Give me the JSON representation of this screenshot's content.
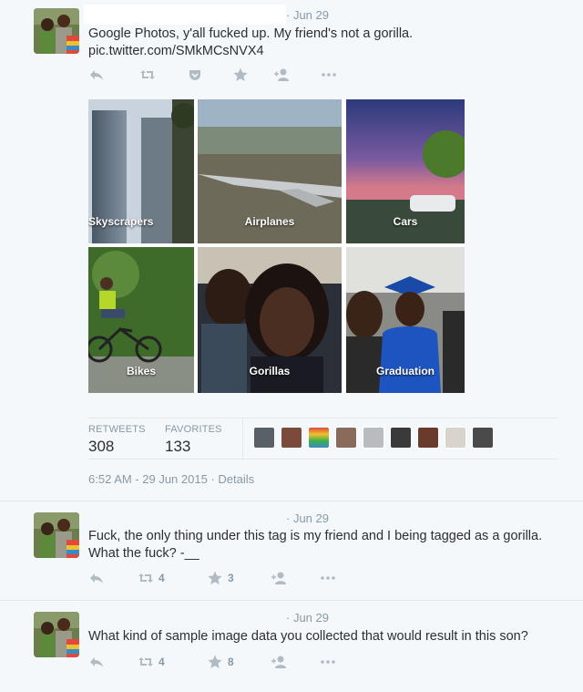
{
  "tweets": [
    {
      "date": "· Jun 29",
      "text_line1": "Google Photos, y'all fucked up. My friend's not a gorilla.",
      "link": "pic.twitter.com/SMkMCsNVX4",
      "actions": [
        {
          "icon": "reply-icon",
          "count": ""
        },
        {
          "icon": "retweet-icon",
          "count": ""
        },
        {
          "icon": "pocket-icon",
          "count": ""
        },
        {
          "icon": "star-icon",
          "count": ""
        },
        {
          "icon": "follow-icon",
          "count": ""
        },
        {
          "icon": "more-icon",
          "count": ""
        }
      ],
      "photo_grid": [
        {
          "label": "Skyscrapers"
        },
        {
          "label": "Airplanes"
        },
        {
          "label": "Cars"
        },
        {
          "label": "Bikes"
        },
        {
          "label": "Gorillas"
        },
        {
          "label": "Graduation"
        }
      ],
      "stats": {
        "retweets_label": "RETWEETS",
        "retweets": "308",
        "favorites_label": "FAVORITES",
        "favorites": "133"
      },
      "timestamp": "6:52 AM - 29 Jun 2015",
      "details": "· Details"
    },
    {
      "date": "· Jun 29",
      "text_line1": "Fuck, the only thing under this tag is my friend and I being tagged as a gorilla.",
      "text_line2": "What the fuck? -__",
      "retweets": "4",
      "favorites": "3"
    },
    {
      "date": "· Jun 29",
      "text_line1": "What kind of sample image data you collected that would result in this son?",
      "retweets": "4",
      "favorites": "8"
    }
  ],
  "colors": {
    "background": "#f5f8fa",
    "text": "#292f33",
    "muted": "#8899a6",
    "icon": "#b1bbc3",
    "border": "#e1e8ed"
  }
}
